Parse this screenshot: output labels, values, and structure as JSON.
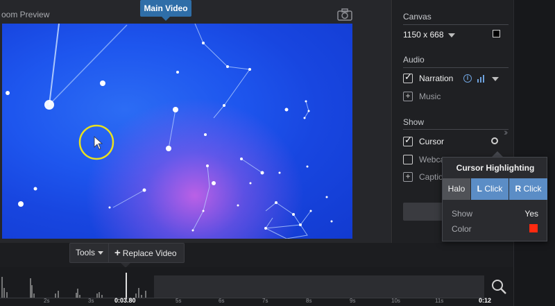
{
  "preview": {
    "title": "oom Preview",
    "main_video_tag": "Main Video",
    "camera_icon": "camera-icon"
  },
  "panel": {
    "canvas": {
      "title": "Canvas",
      "size": "1150 x 668",
      "color": "#000000"
    },
    "audio": {
      "title": "Audio",
      "narration": {
        "label": "Narration",
        "checked": true
      },
      "music": {
        "label": "Music"
      }
    },
    "show": {
      "title": "Show",
      "cursor": {
        "label": "Cursor",
        "checked": true
      },
      "webcam": {
        "label": "Webca",
        "checked": false
      },
      "captions": {
        "label": "Captio"
      }
    }
  },
  "cursor_popup": {
    "title": "Cursor Highlighting",
    "segments": {
      "halo": "Halo",
      "l_prefix": "L",
      "l_label": "Click",
      "r_prefix": "R",
      "r_label": "Click"
    },
    "show_label": "Show",
    "show_value": "Yes",
    "color_label": "Color",
    "color_value": "#ff2a10"
  },
  "toolbar": {
    "tools_label": "Tools",
    "replace_label": "Replace Video"
  },
  "timeline": {
    "current_time": "0:03.80",
    "end_time": "0:12",
    "ticks": [
      "2s",
      "3s",
      "5s",
      "6s",
      "7s",
      "8s",
      "9s",
      "10s",
      "11s"
    ]
  },
  "colors": {
    "accent": "#2f6ea8",
    "selected_segment": "#5b8dc6",
    "halo_ring": "#e8e020"
  }
}
